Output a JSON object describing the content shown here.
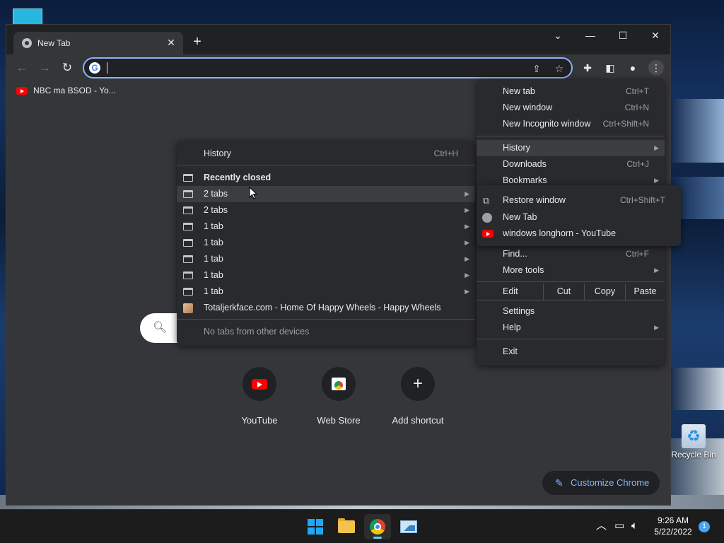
{
  "taskbar": {
    "time": "9:26 AM",
    "date": "5/22/2022",
    "notification_count": "1"
  },
  "desktop": {
    "recycle_bin_label": "Recycle Bin"
  },
  "browser": {
    "tab_title": "New Tab",
    "address_value": "",
    "bookmark_label": "NBC ma BSOD - Yo...",
    "search_placeholder": "",
    "shortcuts": [
      {
        "label": "YouTube"
      },
      {
        "label": "Web Store"
      },
      {
        "label": "Add shortcut"
      }
    ],
    "customize_label": "Customize Chrome"
  },
  "main_menu": {
    "items": [
      {
        "label": "New tab",
        "shortcut": "Ctrl+T"
      },
      {
        "label": "New window",
        "shortcut": "Ctrl+N"
      },
      {
        "label": "New Incognito window",
        "shortcut": "Ctrl+Shift+N"
      },
      {
        "label": "History"
      },
      {
        "label": "Downloads",
        "shortcut": "Ctrl+J"
      },
      {
        "label": "Bookmarks"
      },
      {
        "label": "Find...",
        "shortcut": "Ctrl+F"
      },
      {
        "label": "More tools"
      },
      {
        "label": "Settings"
      },
      {
        "label": "Help"
      },
      {
        "label": "Exit"
      }
    ],
    "edit": {
      "label": "Edit",
      "cut": "Cut",
      "copy": "Copy",
      "paste": "Paste"
    }
  },
  "bookmarks_submenu": {
    "items": [
      {
        "label": "Restore window",
        "shortcut": "Ctrl+Shift+T"
      },
      {
        "label": "New Tab"
      },
      {
        "label": "windows longhorn - YouTube"
      }
    ]
  },
  "history_menu": {
    "header": "History",
    "header_shortcut": "Ctrl+H",
    "recently_closed": "Recently closed",
    "entries": [
      "2 tabs",
      "2 tabs",
      "1 tab",
      "1 tab",
      "1 tab",
      "1 tab",
      "1 tab"
    ],
    "site_entry": "Totaljerkface.com - Home Of Happy Wheels - Happy Wheels",
    "no_tabs": "No tabs from other devices"
  }
}
